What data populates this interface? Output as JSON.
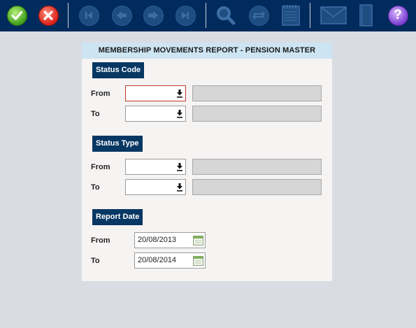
{
  "icons": {
    "ok": "check-circle-icon",
    "cancel": "x-circle-icon",
    "first": "first-record-icon",
    "prev": "previous-record-icon",
    "next": "next-record-icon",
    "last": "last-record-icon",
    "search": "magnifier-icon",
    "refresh": "refresh-icon",
    "notepad": "notepad-icon",
    "mail": "envelope-icon",
    "book": "book-icon",
    "help": "help-icon"
  },
  "colors": {
    "toolbar": "#002b5c",
    "section_label": "#073763",
    "title_bar": "#cde4f3",
    "active_border": "#c0392b"
  },
  "toolbar": {
    "help_glyph": "?"
  },
  "form": {
    "title": "MEMBERSHIP MOVEMENTS REPORT - PENSION MASTER",
    "status_code": {
      "label": "Status Code",
      "from_label": "From",
      "to_label": "To",
      "from_value": "",
      "to_value": ""
    },
    "status_type": {
      "label": "Status Type",
      "from_label": "From",
      "to_label": "To",
      "from_value": "",
      "to_value": ""
    },
    "report_date": {
      "label": "Report Date",
      "from_label": "From",
      "to_label": "To",
      "from_value": "20/08/2013",
      "to_value": "20/08/2014"
    }
  }
}
